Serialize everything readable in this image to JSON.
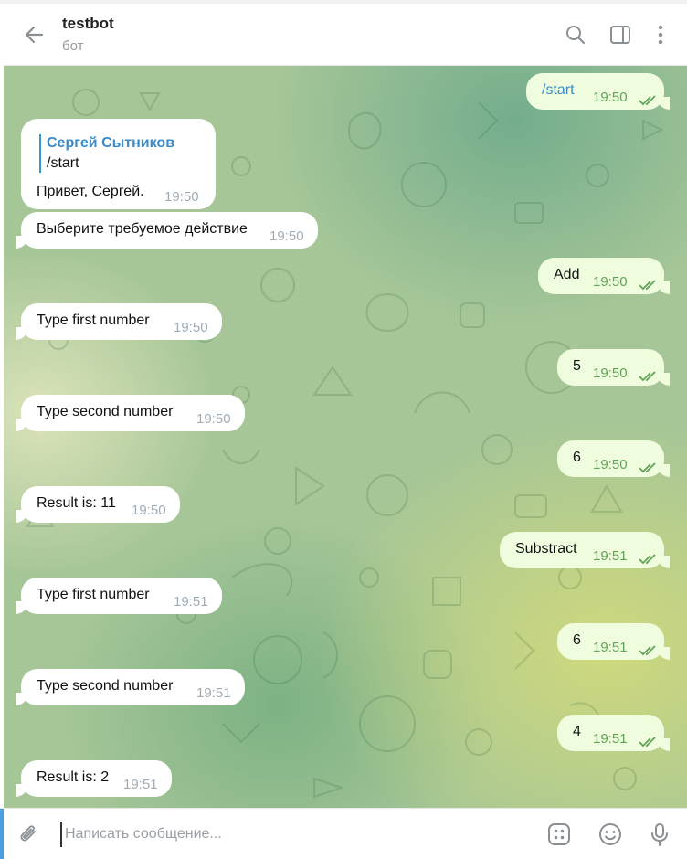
{
  "header": {
    "title": "testbot",
    "subtitle": "бот",
    "icons": [
      "back-arrow-icon",
      "search-icon",
      "sidebar-toggle-icon",
      "more-vertical-icon"
    ]
  },
  "chat": {
    "reply_message": {
      "quoted_author": "Сергей Сытников",
      "quoted_text": "/start",
      "text": "Привет, Сергей.",
      "time": "19:50"
    },
    "messages": [
      {
        "dir": "out",
        "text": "/start",
        "time": "19:50",
        "read": true,
        "text_color": "#3a8bc8"
      },
      {
        "dir": "in",
        "text": "Выберите требуемое действие",
        "time": "19:50"
      },
      {
        "dir": "out",
        "text": "Add",
        "time": "19:50",
        "read": true
      },
      {
        "dir": "in",
        "text": "Type first number",
        "time": "19:50"
      },
      {
        "dir": "out",
        "text": "5",
        "time": "19:50",
        "read": true
      },
      {
        "dir": "in",
        "text": "Type second number",
        "time": "19:50"
      },
      {
        "dir": "out",
        "text": "6",
        "time": "19:50",
        "read": true
      },
      {
        "dir": "in",
        "text": "Result is: 11",
        "time": "19:50"
      },
      {
        "dir": "out",
        "text": "Substract",
        "time": "19:51",
        "read": true
      },
      {
        "dir": "in",
        "text": "Type first number",
        "time": "19:51"
      },
      {
        "dir": "out",
        "text": "6",
        "time": "19:51",
        "read": true
      },
      {
        "dir": "in",
        "text": "Type second number",
        "time": "19:51"
      },
      {
        "dir": "out",
        "text": "4",
        "time": "19:51",
        "read": true
      },
      {
        "dir": "in",
        "text": "Result is: 2",
        "time": "19:51"
      }
    ]
  },
  "composer": {
    "placeholder": "Написать сообщение...",
    "icons": [
      "paperclip-icon",
      "bot-commands-icon",
      "emoji-icon",
      "microphone-icon"
    ]
  },
  "colors": {
    "incoming_bubble": "#ffffff",
    "outgoing_bubble": "#effdde",
    "accent": "#3a8bc8",
    "read_ticks": "#5fa356"
  }
}
